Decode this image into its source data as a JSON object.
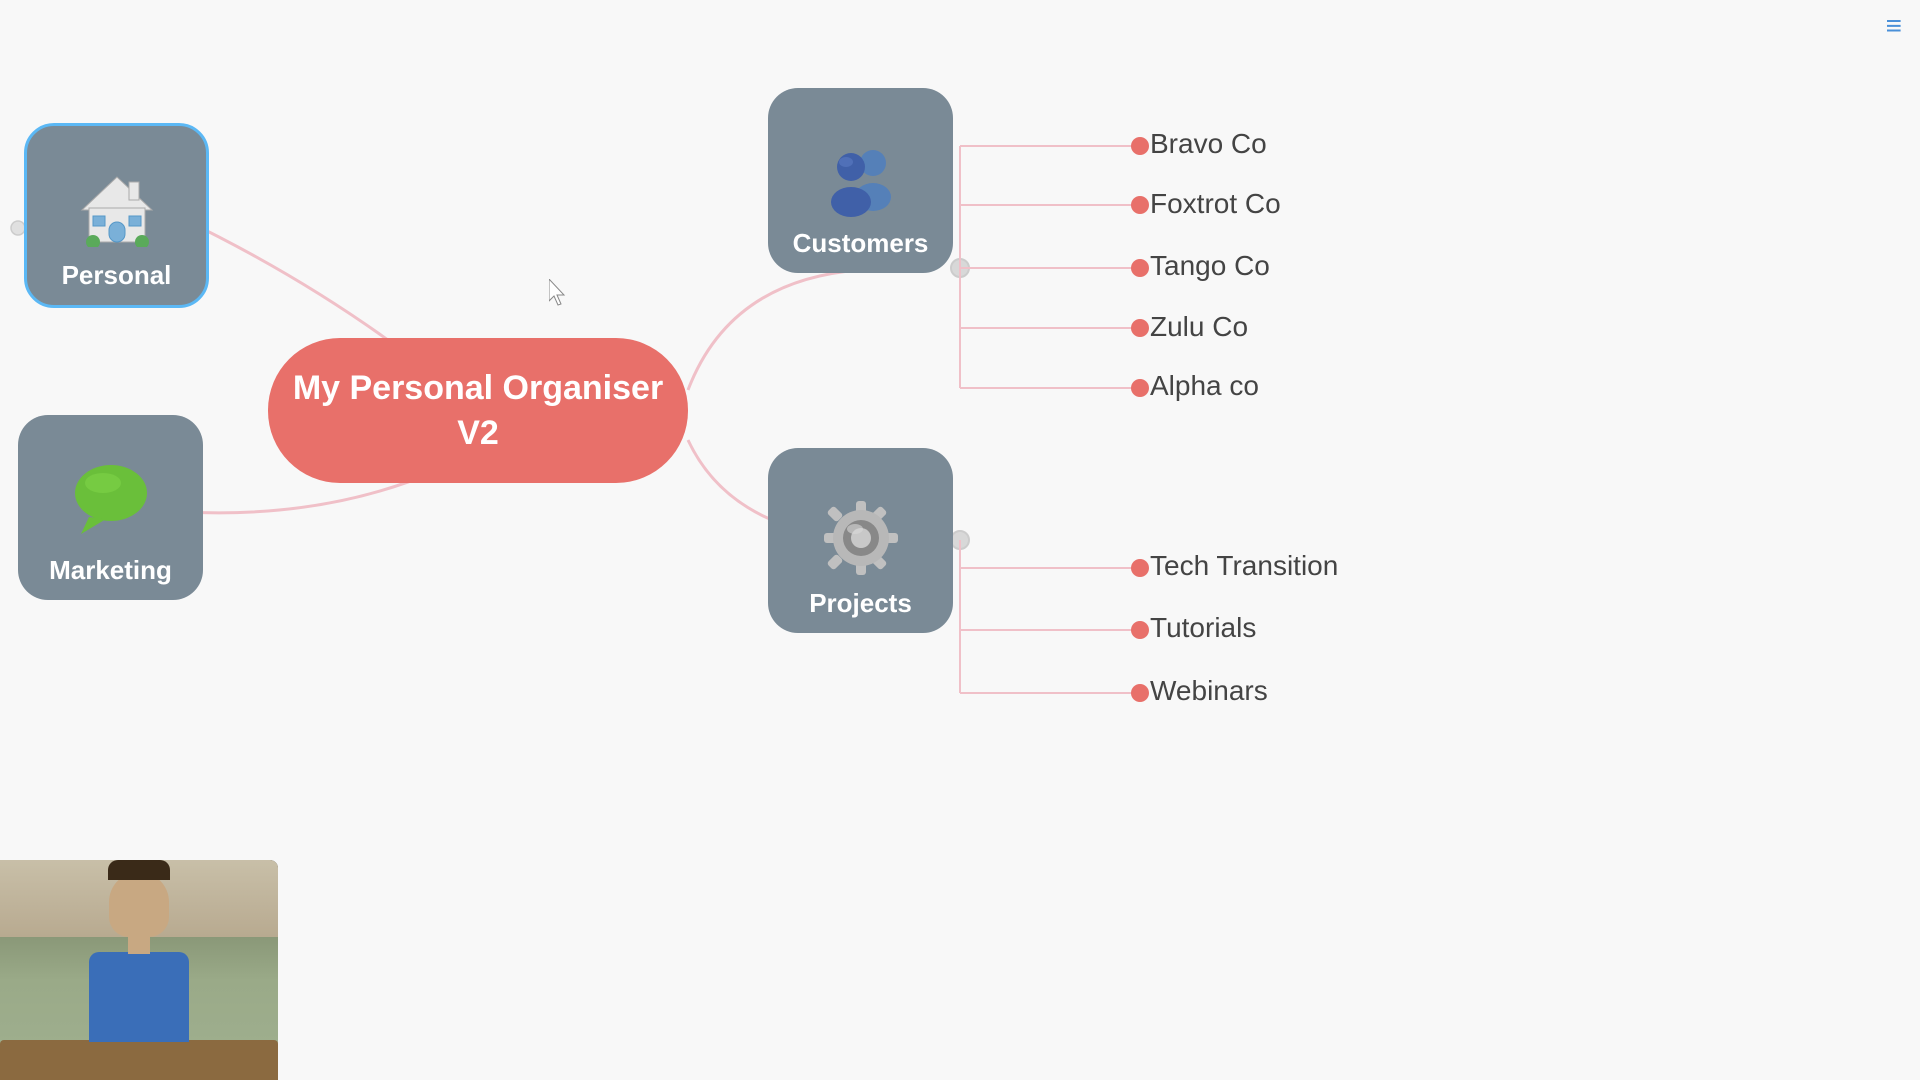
{
  "app": {
    "title": "My Personal Organiser V2"
  },
  "menu": {
    "icon": "≡"
  },
  "central": {
    "label_line1": "My Personal Organiser",
    "label_line2": "V2"
  },
  "branches": [
    {
      "id": "personal",
      "label": "Personal",
      "icon_type": "house",
      "class": "personal"
    },
    {
      "id": "marketing",
      "label": "Marketing",
      "icon_type": "chat",
      "class": "marketing"
    },
    {
      "id": "customers",
      "label": "Customers",
      "icon_type": "people",
      "class": "customers"
    },
    {
      "id": "projects",
      "label": "Projects",
      "icon_type": "gear",
      "class": "projects"
    }
  ],
  "customers_leaves": [
    {
      "id": "bravo",
      "label": "Bravo Co"
    },
    {
      "id": "foxtrot",
      "label": "Foxtrot Co"
    },
    {
      "id": "tango",
      "label": "Tango Co"
    },
    {
      "id": "zulu",
      "label": "Zulu Co"
    },
    {
      "id": "alpha",
      "label": "Alpha co"
    }
  ],
  "projects_leaves": [
    {
      "id": "tech",
      "label": "Tech Transition"
    },
    {
      "id": "tutorials",
      "label": "Tutorials"
    },
    {
      "id": "webinars",
      "label": "Webinars"
    }
  ]
}
